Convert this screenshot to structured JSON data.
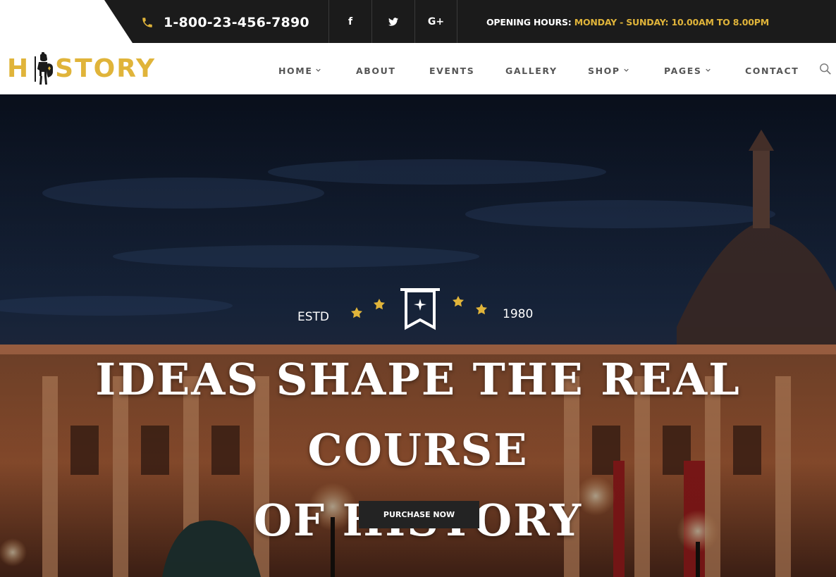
{
  "colors": {
    "accent": "#e0b43a",
    "topbar_bg": "#1b1b1b",
    "nav_text": "#555555"
  },
  "topbar": {
    "phone_icon": "phone-icon",
    "phone": "1-800-23-456-7890",
    "social": [
      {
        "name": "facebook-icon",
        "glyph": "f"
      },
      {
        "name": "twitter-icon",
        "glyph": "t"
      },
      {
        "name": "google-plus-icon",
        "glyph": "G+"
      }
    ],
    "hours_label": "OPENING HOURS:",
    "hours_value": "MONDAY - SUNDAY: 10.00AM TO 8.00PM"
  },
  "logo": {
    "part1": "H",
    "part2": "STORY"
  },
  "nav": {
    "items": [
      {
        "label": "HOME",
        "dropdown": true
      },
      {
        "label": "ABOUT",
        "dropdown": false
      },
      {
        "label": "EVENTS",
        "dropdown": false
      },
      {
        "label": "GALLERY",
        "dropdown": false
      },
      {
        "label": "SHOP",
        "dropdown": true
      },
      {
        "label": "PAGES",
        "dropdown": true
      },
      {
        "label": "CONTACT",
        "dropdown": false
      }
    ],
    "search_icon": "search-icon"
  },
  "hero": {
    "estd": "ESTD",
    "year": "1980",
    "headline_line1": "IDEAS SHAPE THE REAL COURSE",
    "headline_line2": "OF HISTORY",
    "cta": "PURCHASE NOW"
  }
}
